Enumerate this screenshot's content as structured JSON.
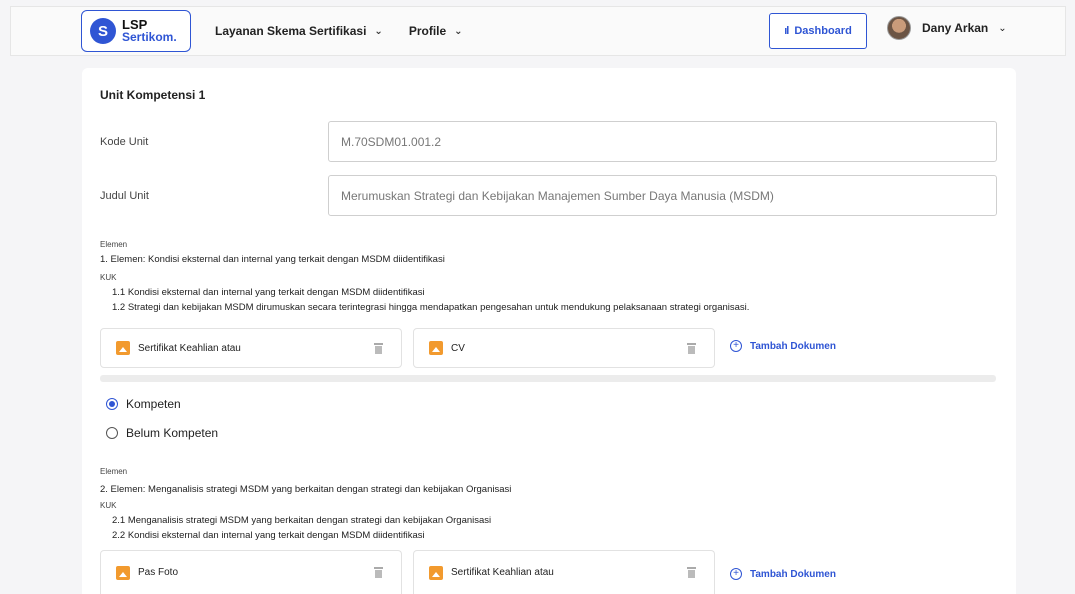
{
  "navbar": {
    "logo": {
      "line1": "LSP",
      "line2": "Sertikom.",
      "badge": "S"
    },
    "menu": [
      {
        "label": "Layanan Skema Sertifikasi"
      },
      {
        "label": "Profile"
      }
    ],
    "dashboard_label": "Dashboard",
    "user_name": "Dany Arkan"
  },
  "unit": {
    "title": "Unit Kompetensi 1",
    "kode_label": "Kode Unit",
    "kode_value": "M.70SDM01.001.2",
    "judul_label": "Judul Unit",
    "judul_value": "Merumuskan Strategi dan Kebijakan Manajemen Sumber Daya Manusia (MSDM)"
  },
  "elements": [
    {
      "elemen_label": "Elemen",
      "elemen_text": "1.  Elemen: Kondisi eksternal dan internal yang terkait dengan MSDM diidentifikasi",
      "kuk_label": "KUK",
      "kuk": [
        "1.1  Kondisi eksternal dan internal yang terkait dengan MSDM diidentifikasi",
        "1.2  Strategi dan kebijakan MSDM dirumuskan secara terintegrasi hingga mendapatkan pengesahan untuk mendukung pelaksanaan strategi organisasi."
      ],
      "documents": [
        "Sertifikat Keahlian atau",
        "CV"
      ],
      "add_label": "Tambah Dokumen"
    },
    {
      "elemen_label": "Elemen",
      "elemen_text": "2.  Elemen: Menganalisis strategi MSDM yang berkaitan dengan strategi dan kebijakan Organisasi",
      "kuk_label": "KUK",
      "kuk": [
        "2.1  Menganalisis strategi MSDM yang berkaitan dengan strategi dan kebijakan Organisasi",
        "2.2  Kondisi eksternal dan internal yang terkait dengan MSDM diidentifikasi"
      ],
      "documents": [
        "Pas Foto",
        "Sertifikat Keahlian atau"
      ],
      "add_label": "Tambah Dokumen"
    }
  ],
  "assessment": {
    "options": [
      "Kompeten",
      "Belum Kompeten"
    ],
    "selected": "Kompeten"
  },
  "colors": {
    "accent": "#2f55d4",
    "doc_icon": "#f29a2e"
  }
}
